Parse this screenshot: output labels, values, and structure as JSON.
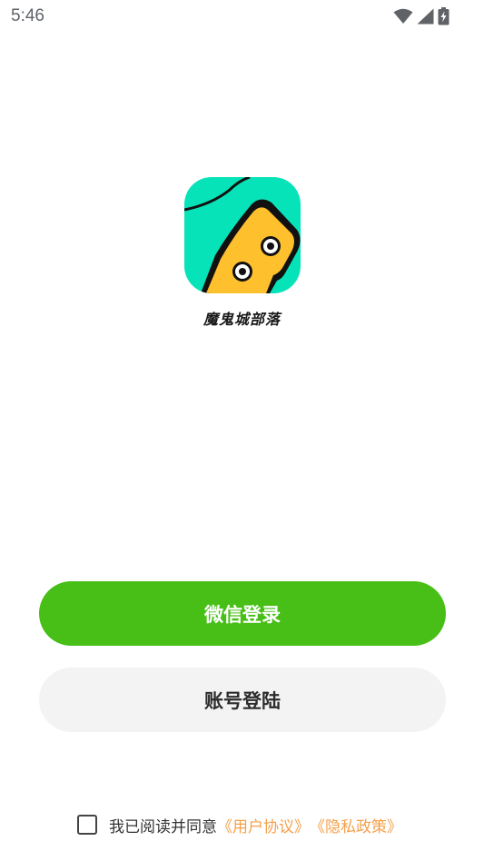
{
  "status_bar": {
    "time": "5:46",
    "icons": [
      "wifi-icon",
      "cell-signal-icon",
      "battery-charging-icon"
    ]
  },
  "app": {
    "name": "魔鬼城部落",
    "logo_icon": "monster-face-logo"
  },
  "buttons": {
    "wechat_login": "微信登录",
    "account_login": "账号登陆"
  },
  "agreement": {
    "checked": false,
    "text": "我已阅读并同意",
    "user_agreement": "《用户协议》",
    "privacy_policy": "《隐私政策》"
  },
  "colors": {
    "wechat_green": "#47bf17",
    "account_gray": "#f3f3f3",
    "link_orange": "#f5a04a",
    "logo_teal": "#07e3b9",
    "logo_yellow": "#ffc02e"
  }
}
